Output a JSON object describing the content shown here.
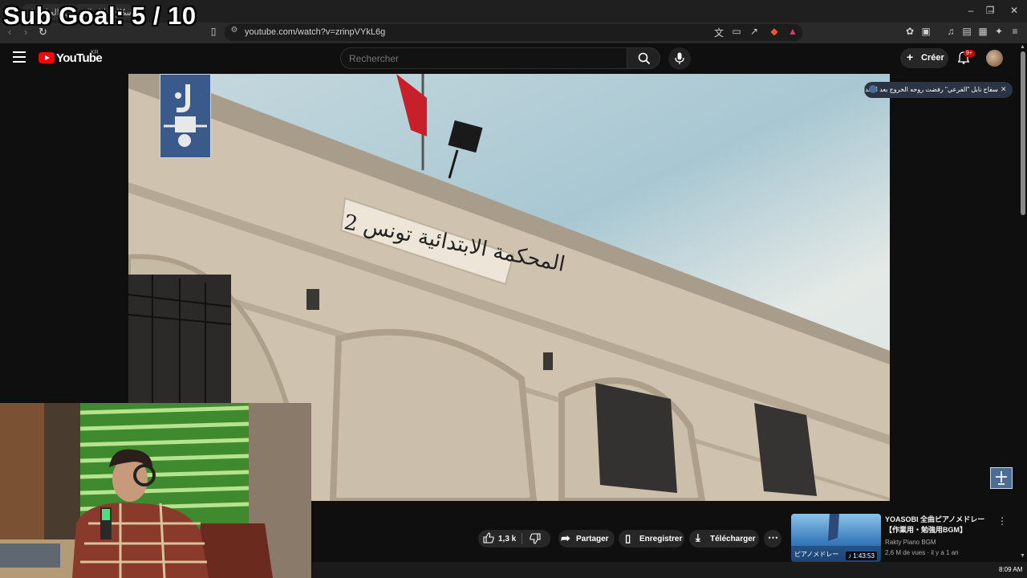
{
  "overlay": {
    "sub_goal": "Sub Goal: 5 / 10"
  },
  "browser": {
    "tab_title": "سفاح نابل الفرعي \"الحلقة 4\"",
    "url": "youtube.com/watch?v=zrinpVYkL6g"
  },
  "youtube": {
    "logo_text": "YouTube",
    "region": "KR",
    "search_placeholder": "Rechercher",
    "create_label": "Créer",
    "notification_count": "9+"
  },
  "video": {
    "sign_text": "المحكمة الابتدائية تونس 2"
  },
  "notification_chip": {
    "text": "سفاح نابل \"الفرعي\" رفضت روحه الخروج بعد الإعدام !"
  },
  "actions": {
    "like_count": "1,3 k",
    "share_label": "Partager",
    "save_label": "Enregistrer",
    "download_label": "Télécharger"
  },
  "recommendation": {
    "title": "YOASOBI 全曲ピアノメドレー【作業用・勉強用BGM】",
    "channel": "Rakty Piano BGM",
    "meta": "2,6 M de vues · il y a 1 an",
    "duration": "1:43:53",
    "thumb_text": "ピアノメドレー"
  },
  "taskbar": {
    "time": "8:09 AM"
  },
  "colors": {
    "youtube_red": "#ff0000",
    "background": "#0f0f0f",
    "pill": "#272727"
  }
}
